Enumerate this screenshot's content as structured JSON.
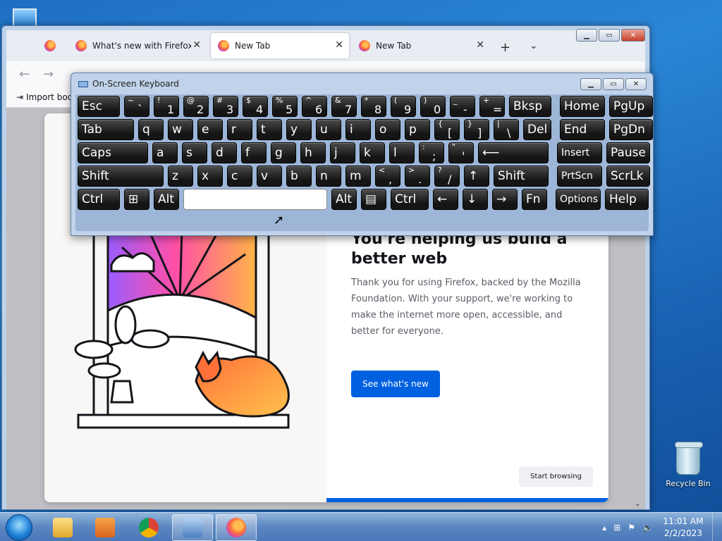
{
  "browser": {
    "tabs": [
      {
        "label": "",
        "active": false
      },
      {
        "label": "What's new with Firefox - M",
        "active": false
      },
      {
        "label": "New Tab",
        "active": true
      },
      {
        "label": "New Tab",
        "active": false
      }
    ],
    "new_tab_icon": "plus-icon",
    "tab_list_icon": "chevron-down-icon",
    "bookmarks": {
      "import_label": "Import boo"
    }
  },
  "modal": {
    "heading": "You're helping us build a better web",
    "body": "Thank you for using Firefox, backed by the Mozilla Foundation. With your support, we're working to make the internet more open, accessible, and better for everyone.",
    "cta": "See what's new",
    "secondary": "Start browsing",
    "accent": "#0061e0"
  },
  "osk": {
    "title": "On-Screen Keyboard",
    "rows": [
      [
        {
          "label": "Esc"
        },
        {
          "shift": "~",
          "main": "`"
        },
        {
          "shift": "!",
          "main": "1"
        },
        {
          "shift": "@",
          "main": "2"
        },
        {
          "shift": "#",
          "main": "3"
        },
        {
          "shift": "$",
          "main": "4"
        },
        {
          "shift": "%",
          "main": "5"
        },
        {
          "shift": "^",
          "main": "6"
        },
        {
          "shift": "&",
          "main": "7"
        },
        {
          "shift": "*",
          "main": "8"
        },
        {
          "shift": "(",
          "main": "9"
        },
        {
          "shift": ")",
          "main": "0"
        },
        {
          "shift": "_",
          "main": "-"
        },
        {
          "shift": "+",
          "main": "="
        },
        {
          "label": "Bksp"
        },
        {
          "label": "Home"
        },
        {
          "label": "PgUp"
        }
      ],
      [
        {
          "label": "Tab"
        },
        {
          "label": "q"
        },
        {
          "label": "w"
        },
        {
          "label": "e"
        },
        {
          "label": "r"
        },
        {
          "label": "t"
        },
        {
          "label": "y"
        },
        {
          "label": "u"
        },
        {
          "label": "i"
        },
        {
          "label": "o"
        },
        {
          "label": "p"
        },
        {
          "shift": "{",
          "main": "["
        },
        {
          "shift": "}",
          "main": "]"
        },
        {
          "shift": "|",
          "main": "\\"
        },
        {
          "label": "Del"
        },
        {
          "label": "End"
        },
        {
          "label": "PgDn"
        }
      ],
      [
        {
          "label": "Caps"
        },
        {
          "label": "a"
        },
        {
          "label": "s"
        },
        {
          "label": "d"
        },
        {
          "label": "f"
        },
        {
          "label": "g"
        },
        {
          "label": "h"
        },
        {
          "label": "j"
        },
        {
          "label": "k"
        },
        {
          "label": "l"
        },
        {
          "shift": ":",
          "main": ";"
        },
        {
          "shift": "\"",
          "main": "'"
        },
        {
          "label": "⟵"
        },
        {
          "label": "Insert"
        },
        {
          "label": "Pause"
        }
      ],
      [
        {
          "label": "Shift"
        },
        {
          "label": "z"
        },
        {
          "label": "x"
        },
        {
          "label": "c"
        },
        {
          "label": "v"
        },
        {
          "label": "b"
        },
        {
          "label": "n"
        },
        {
          "label": "m"
        },
        {
          "shift": "<",
          "main": ","
        },
        {
          "shift": ">",
          "main": "."
        },
        {
          "shift": "?",
          "main": "/"
        },
        {
          "label": "↑"
        },
        {
          "label": "Shift"
        },
        {
          "label": "PrtScn"
        },
        {
          "label": "ScrLk"
        }
      ],
      [
        {
          "label": "Ctrl"
        },
        {
          "label": "⊞"
        },
        {
          "label": "Alt"
        },
        {
          "label": ""
        },
        {
          "label": "Alt"
        },
        {
          "label": "▤"
        },
        {
          "label": "Ctrl"
        },
        {
          "label": "←"
        },
        {
          "label": "↓"
        },
        {
          "label": "→"
        },
        {
          "label": "Fn"
        },
        {
          "label": "Options"
        },
        {
          "label": "Help"
        }
      ]
    ]
  },
  "desktop": {
    "recycle_bin": "Recycle Bin"
  },
  "taskbar": {
    "time": "11:01 AM",
    "date": "2/2/2023"
  }
}
